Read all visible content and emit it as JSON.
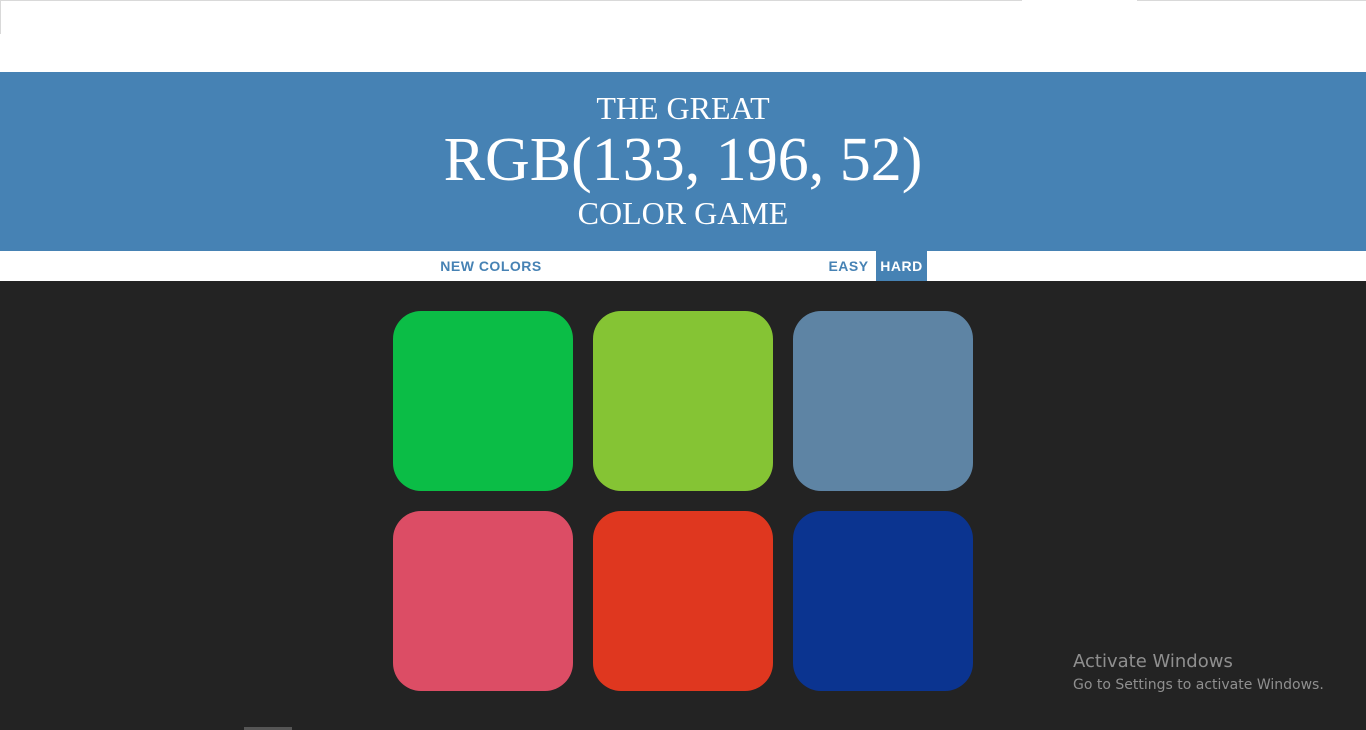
{
  "header": {
    "line1": "THE GREAT",
    "target_rgb": "RGB(133, 196, 52)",
    "line3": "COLOR GAME",
    "background": "#4682b4"
  },
  "controls": {
    "new_colors_label": "NEW COLORS",
    "message": "",
    "easy_label": "EASY",
    "hard_label": "HARD",
    "selected_mode": "HARD"
  },
  "squares": [
    {
      "color": "#0bbd46"
    },
    {
      "color": "#85c434"
    },
    {
      "color": "#5e84a4"
    },
    {
      "color": "#dc4d65"
    },
    {
      "color": "#df371f"
    },
    {
      "color": "#0b3490"
    }
  ],
  "overlay": {
    "title": "Activate Windows",
    "subtitle": "Go to Settings to activate Windows."
  }
}
